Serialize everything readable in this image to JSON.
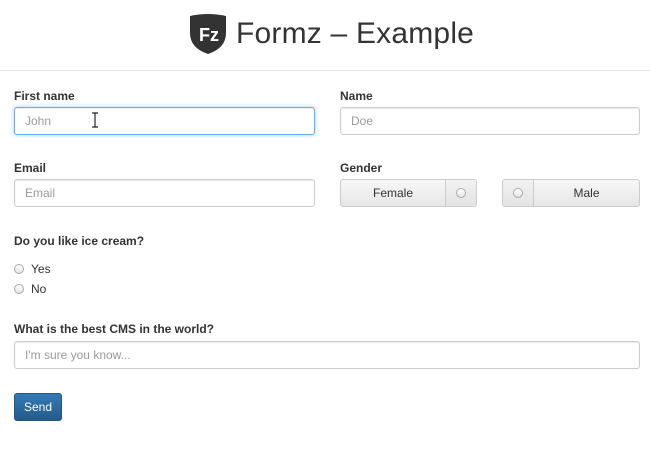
{
  "header": {
    "logo_text": "Fz",
    "title": "Formz – Example"
  },
  "form": {
    "first_name": {
      "label": "First name",
      "placeholder": "John",
      "value": ""
    },
    "name": {
      "label": "Name",
      "placeholder": "Doe",
      "value": ""
    },
    "email": {
      "label": "Email",
      "placeholder": "Email",
      "value": ""
    },
    "gender": {
      "label": "Gender",
      "options": [
        "Female",
        "Male"
      ],
      "selected": null
    },
    "ice_cream": {
      "label": "Do you like ice cream?",
      "options": [
        "Yes",
        "No"
      ],
      "selected": null
    },
    "best_cms": {
      "label": "What is the best CMS in the world?",
      "placeholder": "I'm sure you know...",
      "value": ""
    },
    "submit_label": "Send"
  },
  "colors": {
    "focus_border": "#66afe9",
    "primary_button": "#337ab7",
    "logo_fill": "#333333"
  }
}
